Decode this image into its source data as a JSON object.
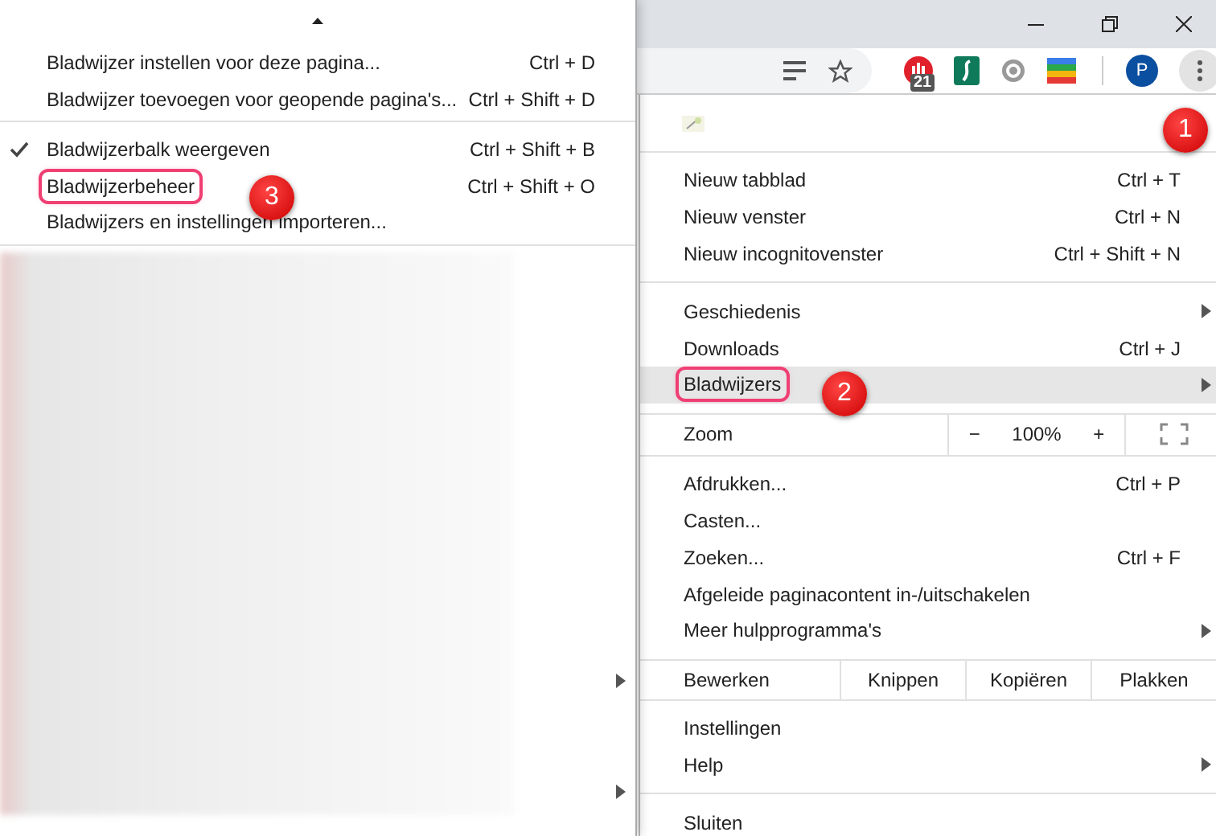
{
  "toolbar": {
    "extension_badge": "21",
    "avatar": "P"
  },
  "bookmarks_submenu": {
    "groups": [
      [
        {
          "label": "Bladwijzer instellen voor deze pagina...",
          "shortcut": "Ctrl + D",
          "checked": false
        },
        {
          "label": "Bladwijzer toevoegen voor geopende pagina's...",
          "shortcut": "Ctrl + Shift + D",
          "checked": false
        }
      ],
      [
        {
          "label": "Bladwijzerbalk weergeven",
          "shortcut": "Ctrl + Shift + B",
          "checked": true
        },
        {
          "label": "Bladwijzerbeheer",
          "shortcut": "Ctrl + Shift + O",
          "checked": false,
          "outlined": true
        },
        {
          "label": "Bladwijzers en instellingen importeren...",
          "checked": false
        }
      ]
    ]
  },
  "main_menu": {
    "groups": [
      [
        {
          "kind": "item",
          "label": "Nieuw tabblad",
          "shortcut": "Ctrl + T",
          "submenu": false,
          "highlighted": false
        },
        {
          "kind": "item",
          "label": "Nieuw venster",
          "shortcut": "Ctrl + N",
          "submenu": false,
          "highlighted": false
        },
        {
          "kind": "item",
          "label": "Nieuw incognitovenster",
          "shortcut": "Ctrl + Shift + N",
          "submenu": false,
          "highlighted": false
        }
      ],
      [
        {
          "kind": "item",
          "label": "Geschiedenis",
          "submenu": true,
          "highlighted": false
        },
        {
          "kind": "item",
          "label": "Downloads",
          "shortcut": "Ctrl + J",
          "submenu": false,
          "highlighted": false
        },
        {
          "kind": "item",
          "label": "Bladwijzers",
          "submenu": true,
          "highlighted": true,
          "outlined": true
        }
      ],
      [
        {
          "kind": "zoom",
          "label": "Zoom",
          "minus": "−",
          "value": "100%",
          "plus": "+"
        }
      ],
      [
        {
          "kind": "item",
          "label": "Afdrukken...",
          "shortcut": "Ctrl + P",
          "submenu": false,
          "highlighted": false
        },
        {
          "kind": "item",
          "label": "Casten...",
          "submenu": false,
          "highlighted": false
        },
        {
          "kind": "item",
          "label": "Zoeken...",
          "shortcut": "Ctrl + F",
          "submenu": false,
          "highlighted": false
        },
        {
          "kind": "item",
          "label": "Afgeleide paginacontent in-/uitschakelen",
          "submenu": false,
          "highlighted": false
        },
        {
          "kind": "item",
          "label": "Meer hulpprogramma's",
          "submenu": true,
          "highlighted": false
        }
      ],
      [
        {
          "kind": "edit",
          "label": "Bewerken",
          "actions": [
            "Knippen",
            "Kopiëren",
            "Plakken"
          ]
        }
      ],
      [
        {
          "kind": "item",
          "label": "Instellingen",
          "submenu": false,
          "highlighted": false
        },
        {
          "kind": "item",
          "label": "Help",
          "submenu": true,
          "highlighted": false
        }
      ],
      [
        {
          "kind": "item",
          "label": "Sluiten",
          "submenu": false,
          "highlighted": false
        }
      ]
    ]
  },
  "annotations": [
    "1",
    "2",
    "3"
  ]
}
